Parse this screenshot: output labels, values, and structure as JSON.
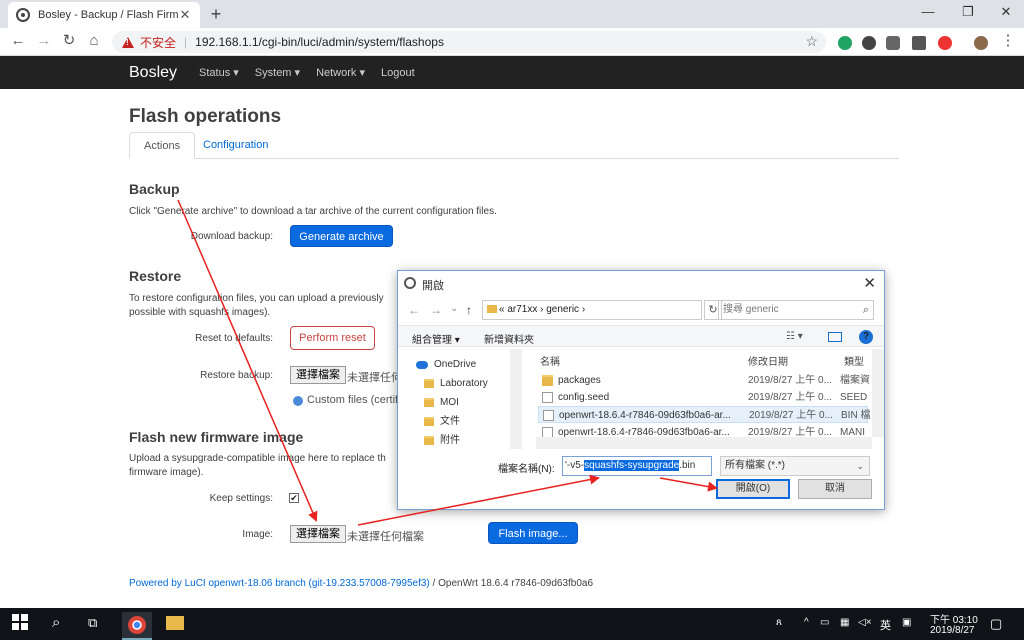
{
  "browser": {
    "tab_title": "Bosley - Backup / Flash Firmwa",
    "insecure_label": "不安全",
    "url": "192.168.1.1/cgi-bin/luci/admin/system/flashops",
    "window_controls": [
      "—",
      "❐",
      "✕"
    ]
  },
  "luci": {
    "brand": "Bosley",
    "menu": [
      "Status ▾",
      "System ▾",
      "Network ▾",
      "Logout"
    ]
  },
  "page": {
    "title": "Flash operations",
    "tabs": [
      "Actions",
      "Configuration"
    ],
    "backup": {
      "title": "Backup",
      "desc": "Click \"Generate archive\" to download a tar archive of the current configuration files.",
      "label": "Download backup:",
      "button": "Generate archive"
    },
    "restore": {
      "title": "Restore",
      "desc_line1": "To restore configuration files, you can upload a previously",
      "desc_line2": "possible with squashfs images).",
      "reset_label": "Reset to defaults:",
      "reset_button": "Perform reset",
      "restore_label": "Restore backup:",
      "file_button": "選擇檔案",
      "file_none": "未選擇任何",
      "custom_files": "Custom files (certific"
    },
    "flash": {
      "title": "Flash new firmware image",
      "desc_line1": "Upload a sysupgrade-compatible image here to replace th",
      "desc_line2": "firmware image).",
      "keep_label": "Keep settings:",
      "keep_checked": "✔",
      "image_label": "Image:",
      "file_button": "選擇檔案",
      "file_none": "未選擇任何檔案",
      "flash_button": "Flash image..."
    },
    "footer_link": "Powered by LuCI openwrt-18.06 branch (git-19.233.57008-7995ef3)",
    "footer_rest": " / OpenWrt 18.6.4 r7846-09d63fb0a6"
  },
  "dialog": {
    "title": "開啟",
    "nav": [
      "←",
      "→",
      "⌄",
      "↑"
    ],
    "path": "«  ar71xx  ›  generic  ›",
    "search_placeholder": "搜尋 generic",
    "organize": "組合管理 ▾",
    "new_folder": "新增資料夾",
    "tree": [
      "OneDrive",
      "Laboratory",
      "MOI",
      "文件",
      "附件"
    ],
    "columns": [
      "名稱",
      "修改日期",
      "類型"
    ],
    "files": [
      {
        "name": "packages",
        "date": "2019/8/27 上午 0...",
        "type": "檔案資",
        "kind": "folder"
      },
      {
        "name": "config.seed",
        "date": "2019/8/27 上午 0...",
        "type": "SEED",
        "kind": "file"
      },
      {
        "name": "openwrt-18.6.4-r7846-09d63fb0a6-ar...",
        "date": "2019/8/27 上午 0...",
        "type": "BIN 檔",
        "kind": "file"
      },
      {
        "name": "openwrt-18.6.4-r7846-09d63fb0a6-ar...",
        "date": "2019/8/27 上午 0...",
        "type": "MANI",
        "kind": "file"
      }
    ],
    "filename_label": "檔案名稱(N):",
    "filename_pre": "'-v5-",
    "filename_sel": "squashfs-sysupgrade",
    "filename_post": ".bin",
    "filter": "所有檔案 (*.*)",
    "open_button": "開啟(O)",
    "cancel_button": "取消"
  },
  "taskbar": {
    "time": "下午 03:10",
    "date": "2019/8/27",
    "ime": "英"
  },
  "colors": {
    "accent": "#0a6ae0",
    "annotation": "#e8231f",
    "luci_bar": "#222222"
  }
}
